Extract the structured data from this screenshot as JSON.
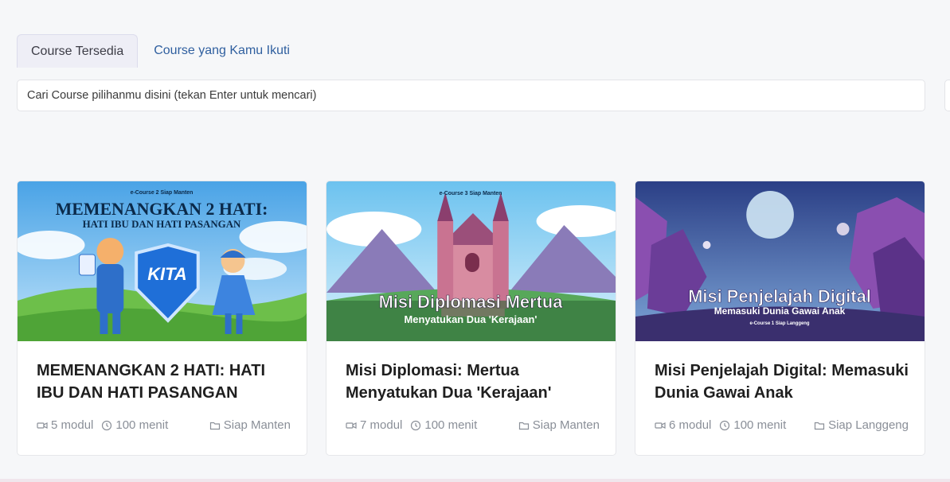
{
  "tabs": [
    {
      "label": "Course Tersedia",
      "active": true
    },
    {
      "label": "Course yang Kamu Ikuti",
      "active": false
    }
  ],
  "search": {
    "placeholder": "Cari Course pilihanmu disini (tekan Enter untuk mencari)"
  },
  "courses": [
    {
      "title": "MEMENANGKAN 2 HATI: HATI IBU DAN HATI PASANGAN",
      "modules": "5 modul",
      "duration": "100 menit",
      "category": "Siap Manten",
      "thumb": {
        "series": "e-Course 2",
        "series_sub": "Siap Manten",
        "headline": "MEMENANGKAN 2 HATI:",
        "subline": "HATI IBU DAN HATI PASANGAN",
        "badge": "KITA"
      }
    },
    {
      "title": "Misi Diplomasi: Mertua Menyatukan Dua 'Kerajaan'",
      "modules": "7 modul",
      "duration": "100 menit",
      "category": "Siap Manten",
      "thumb": {
        "series": "e-Course 3",
        "series_sub": "Siap Manten",
        "headline": "Misi Diplomasi Mertua",
        "subline": "Menyatukan Dua 'Kerajaan'"
      }
    },
    {
      "title": "Misi Penjelajah Digital: Memasuki Dunia Gawai Anak",
      "modules": "6 modul",
      "duration": "100 menit",
      "category": "Siap Langgeng",
      "thumb": {
        "series": "e-Course 1",
        "series_sub": "Siap Langgeng",
        "headline": "Misi Penjelajah Digital",
        "subline": "Memasuki Dunia Gawai Anak"
      }
    }
  ],
  "icons": {
    "module": "video-camera-icon",
    "duration": "clock-icon",
    "category": "folder-icon"
  },
  "colors": {
    "tab_active_bg": "#eeeef6",
    "tab_link": "#2f5f9f",
    "meta_text": "#8a8f98"
  }
}
